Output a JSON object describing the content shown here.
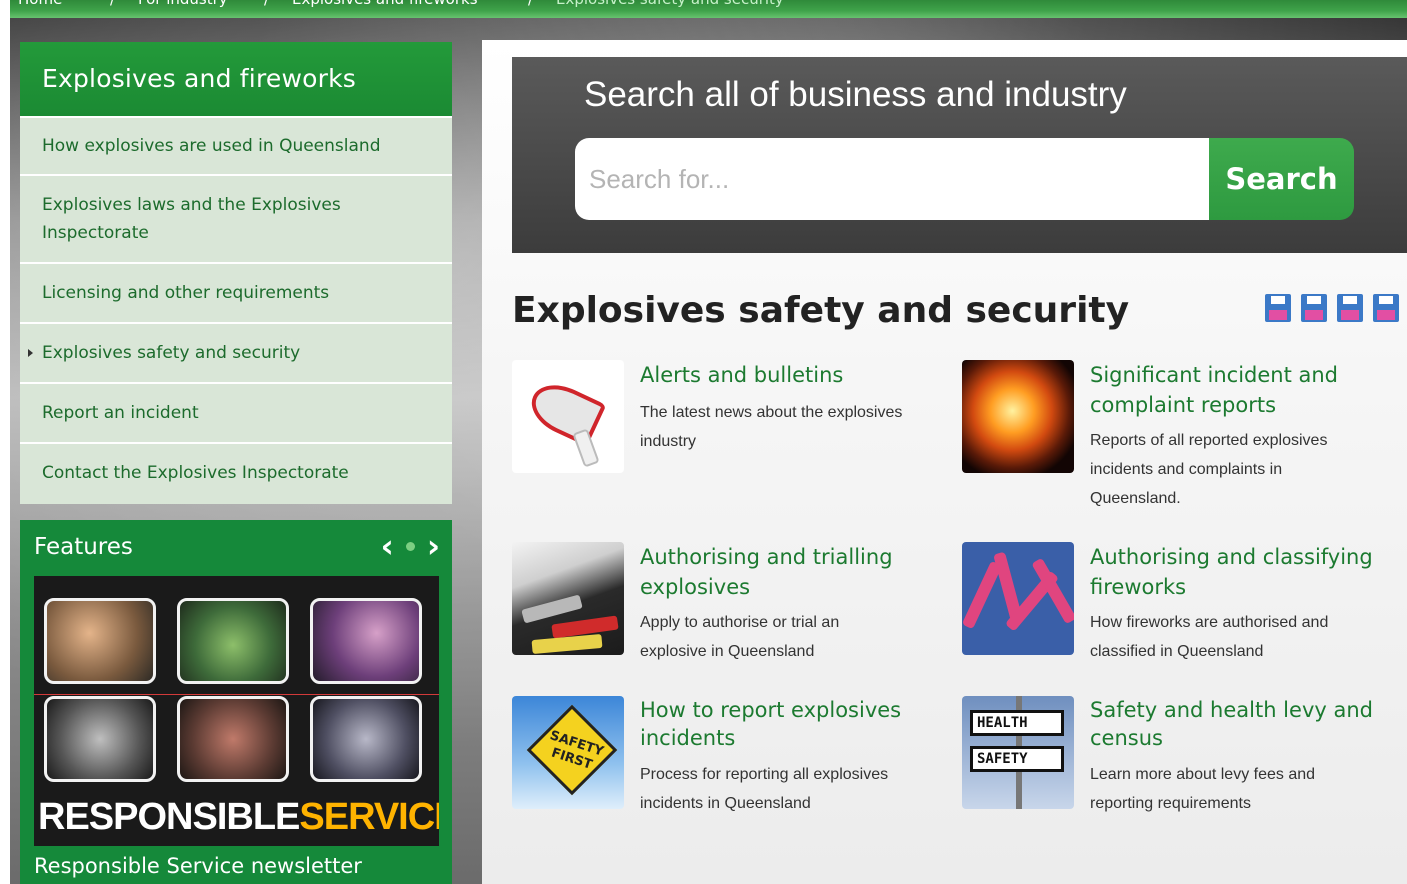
{
  "breadcrumb": {
    "items": [
      "Home",
      "For industry",
      "Explosives and fireworks",
      "Explosives safety and security"
    ]
  },
  "sidebar": {
    "title": "Explosives and fireworks",
    "items": [
      {
        "label": "How explosives are used in Queensland",
        "active": false
      },
      {
        "label": "Explosives laws and the Explosives Inspectorate",
        "active": false
      },
      {
        "label": "Licensing and other requirements",
        "active": false
      },
      {
        "label": "Explosives safety and security",
        "active": true
      },
      {
        "label": "Report an incident",
        "active": false
      },
      {
        "label": "Contact the Explosives Inspectorate",
        "active": false
      }
    ]
  },
  "features": {
    "title": "Features",
    "prev_icon": "chevron-left-icon",
    "next_icon": "chevron-right-icon",
    "banner_word_1": "RESPONSIBLE",
    "banner_word_2": "SERVICE",
    "link": "Responsible Service newsletter"
  },
  "search": {
    "title": "Search all of business and industry",
    "placeholder": "Search for...",
    "value": "",
    "button": "Search"
  },
  "page": {
    "title": "Explosives safety and security",
    "tool_icons": [
      "save-icon",
      "save-icon",
      "save-icon",
      "save-icon"
    ]
  },
  "tiles": [
    {
      "title": "Alerts and bulletins",
      "desc": "The latest news about the explosives industry",
      "icon": "megaphone-icon"
    },
    {
      "title": "Significant incident and complaint reports",
      "desc": "Reports of all reported explosives incidents and complaints in Queensland.",
      "icon": "fire-icon"
    },
    {
      "title": "Authorising and trialling explosives",
      "desc": "Apply to authorise or trial an explosive in Queensland",
      "icon": "explosives-icon"
    },
    {
      "title": "Authorising and classifying fireworks",
      "desc": "How fireworks are authorised and classified in Queensland",
      "icon": "fireworks-icon"
    },
    {
      "title": "How to report explosives incidents",
      "desc": "Process for reporting all explosives incidents in Queensland",
      "icon": "safety-sign-icon"
    },
    {
      "title": "Safety and health levy and census",
      "desc": "Learn more about levy fees and reporting requirements",
      "icon": "health-safety-sign-icon"
    }
  ],
  "thumb_text": {
    "safety_first": "SAFETY FIRST",
    "health": "HEALTH",
    "safety": "SAFETY"
  },
  "colors": {
    "brand_green": "#1b8a33",
    "link_green": "#1c7a30",
    "sidebar_bg": "#d9e6d7",
    "search_bg": "#3c3c3c",
    "accent_orange": "#ffb300"
  }
}
